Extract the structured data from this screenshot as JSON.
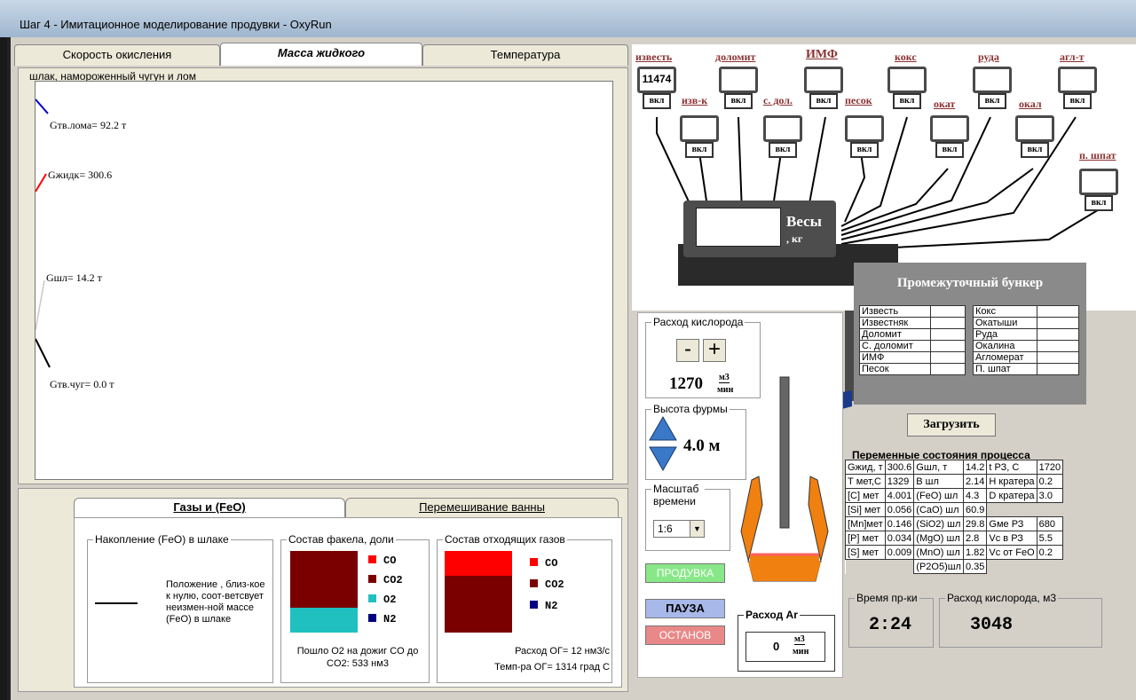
{
  "window": {
    "title": "Шаг 4 - Имитационное моделирование продувки - OxyRun"
  },
  "tabs": [
    {
      "label": "Скорость окисления"
    },
    {
      "label": "Масса жидкого"
    },
    {
      "label": "Температура"
    }
  ],
  "graph": {
    "legend": "шлак, намороженный чугун и лом",
    "labels": {
      "scrap": "Gтв.лома= 92.2 т",
      "liquid": "Gжидк= 300.6",
      "slag": "Gшл= 14.2 т",
      "iron": "Gтв.чуг= 0.0 т"
    }
  },
  "lower": {
    "tabs": [
      {
        "label": "Газы и (FeO)"
      },
      {
        "label": "Перемешивание ванны"
      }
    ],
    "feo_group": {
      "caption": "Накопление (FeO) в шлаке",
      "note": "Положение , близ-кое к нулю, соот-ветсвует неизмен-ной массе (FeO) в шлаке"
    },
    "torch_group": {
      "caption": "Состав факела, доли",
      "legend": [
        "CO",
        "CO2",
        "O2",
        "N2"
      ],
      "footer": "Пошло O2 на дожиг CO до CO2: 533 нм3"
    },
    "off_group": {
      "caption": "Состав отходящих газов",
      "legend": [
        "CO",
        "CO2",
        "N2"
      ],
      "flow": "Расход ОГ= 12 нм3/с",
      "temp": "Темп-ра ОГ= 1314 град С"
    }
  },
  "materials": {
    "top": [
      {
        "id": "izvest",
        "label": "известь",
        "value": "11474"
      },
      {
        "id": "dolomit",
        "label": "доломит",
        "value": ""
      },
      {
        "id": "imf",
        "label": "ИМФ",
        "value": ""
      },
      {
        "id": "koks",
        "label": "кокс",
        "value": ""
      },
      {
        "id": "ruda",
        "label": "руда",
        "value": ""
      },
      {
        "id": "aglt",
        "label": "агл-т",
        "value": ""
      }
    ],
    "second": [
      {
        "id": "izvk",
        "label": "изв-к"
      },
      {
        "id": "sdol",
        "label": "с. дол."
      },
      {
        "id": "pesok",
        "label": "песок"
      },
      {
        "id": "okat",
        "label": "окат"
      },
      {
        "id": "okal",
        "label": "окал"
      },
      {
        "id": "pshpat",
        "label": "п. шпат"
      }
    ],
    "btn": "вкл"
  },
  "scales": {
    "title": "Весы",
    "unit": ", кг"
  },
  "bunker": {
    "title": "Промежуточный бункер",
    "left": [
      "Известь",
      "Известняк",
      "Доломит",
      "С. доломит",
      "ИМФ",
      "Песок"
    ],
    "right": [
      "Кокс",
      "Окатыши",
      "Руда",
      "Окалина",
      "Агломерат",
      "П. шпат"
    ],
    "load_button": "Загрузить"
  },
  "oxygen": {
    "caption": "Расход кислорода",
    "minus": "-",
    "plus": "+",
    "value": "1270",
    "unit_top": "м3",
    "unit_bottom": "мин"
  },
  "lance": {
    "caption": "Высота фурмы",
    "value": "4.0 м"
  },
  "timescale": {
    "caption": "Масштаб времени",
    "value": "1:6"
  },
  "buttons": {
    "blow": "ПРОДУВКА",
    "pause": "ПАУЗА",
    "stop": "ОСТАНОВ"
  },
  "argon": {
    "caption": "Расход Ar",
    "value": "0",
    "unit_top": "м3",
    "unit_bottom": "мин"
  },
  "state": {
    "caption": "Переменные состояния процесса",
    "rows": [
      [
        "Gжид, т",
        "300.6",
        "Gшл, т",
        "14.2",
        "t РЗ, С",
        "1720"
      ],
      [
        "Т мет,С",
        "1329",
        "В шл",
        "2.14",
        "Н кратера",
        "0.2"
      ],
      [
        "[C] мет",
        "4.001",
        "(FeO) шл",
        "4.3",
        "D кратера",
        "3.0"
      ],
      [
        "[Si] мет",
        "0.056",
        "(CaO) шл",
        "60.9",
        "",
        ""
      ],
      [
        "[Mn]мет",
        "0.146",
        "(SiO2) шл",
        "29.8",
        "Gме РЗ",
        "680"
      ],
      [
        "[P] мет",
        "0.034",
        "(MgO) шл",
        "2.8",
        "Vc в РЗ",
        "5.5"
      ],
      [
        "[S] мет",
        "0.009",
        "(MnO) шл",
        "1.82",
        "Vc от FeO",
        "0.2"
      ],
      [
        "",
        "",
        "(P2O5)шл",
        "0.35",
        "",
        ""
      ]
    ]
  },
  "time": {
    "caption": "Время пр-ки",
    "value": "2:24"
  },
  "oxytotal": {
    "caption": "Расход кислорода, м3",
    "value": "3048"
  },
  "colors": {
    "co": "#ff0000",
    "co2": "#7a0000",
    "o2": "#20c0c0",
    "n2": "#000080"
  }
}
